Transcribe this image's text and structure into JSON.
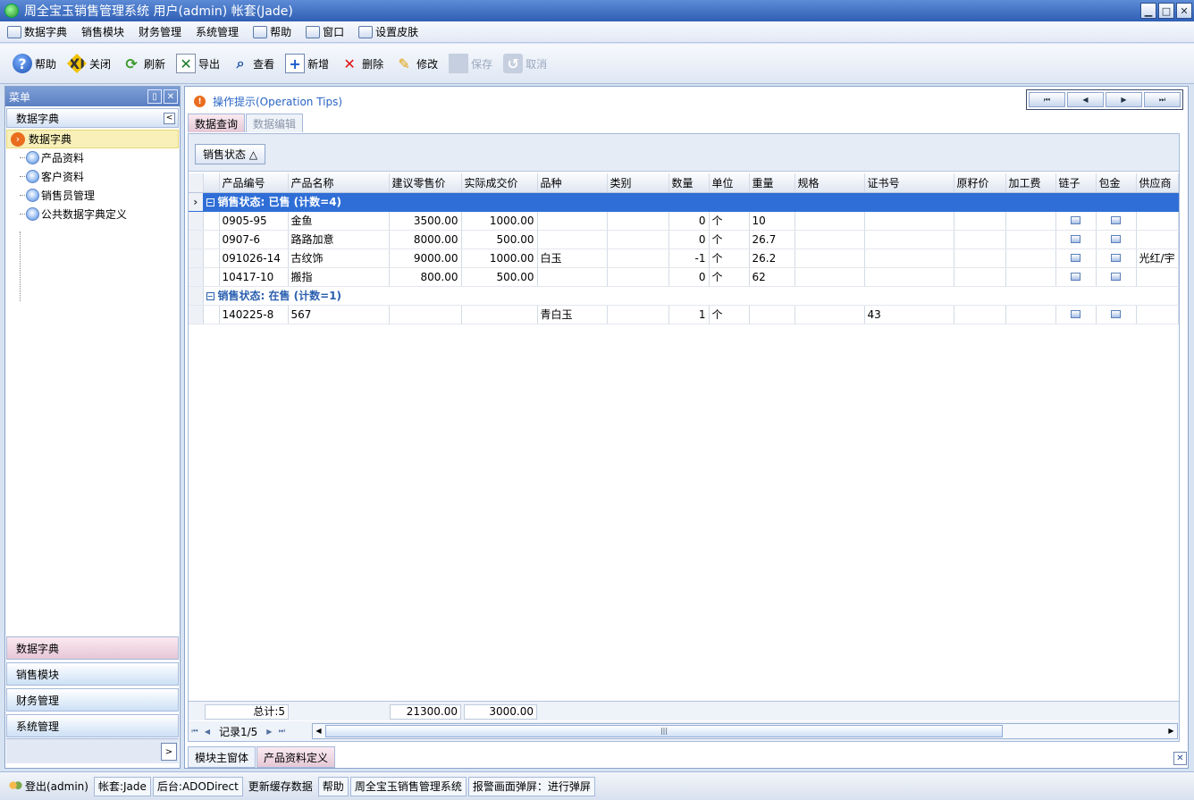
{
  "window": {
    "title": "周全宝玉销售管理系统 用户(admin) 帐套(Jade)"
  },
  "menu": [
    {
      "label": "数据字典",
      "icon": "tree-icon"
    },
    {
      "label": "销售模块"
    },
    {
      "label": "财务管理"
    },
    {
      "label": "系统管理"
    },
    {
      "label": "帮助",
      "icon": "help-icon"
    },
    {
      "label": "窗口",
      "icon": "window-icon"
    },
    {
      "label": "设置皮肤",
      "icon": "skin-icon"
    }
  ],
  "toolbar": {
    "help": "帮助",
    "close": "关闭",
    "close_icon_text": "EXIT",
    "refresh": "刷新",
    "export": "导出",
    "view": "查看",
    "new": "新增",
    "delete": "删除",
    "edit": "修改",
    "save": "保存",
    "cancel": "取消"
  },
  "sidebar": {
    "title": "菜单",
    "group": "数据字典",
    "root": "数据字典",
    "items": [
      "产品资料",
      "客户资料",
      "销售员管理",
      "公共数据字典定义"
    ],
    "nav": [
      "数据字典",
      "销售模块",
      "财务管理",
      "系统管理"
    ]
  },
  "main": {
    "tips": "操作提示(Operation Tips)",
    "tabs": [
      "数据查询",
      "数据编辑"
    ],
    "group_chip": "销售状态 △"
  },
  "grid": {
    "columns": [
      "产品编号",
      "产品名称",
      "建议零售价",
      "实际成交价",
      "品种",
      "类别",
      "数量",
      "单位",
      "重量",
      "规格",
      "证书号",
      "原籽价",
      "加工费",
      "链子",
      "包金",
      "供应商"
    ],
    "group1": "销售状态: 已售 (计数=4)",
    "group2": "销售状态: 在售 (计数=1)",
    "rows1": [
      {
        "code": "0905-95",
        "name": "金鱼",
        "retail": "3500.00",
        "actual": "1000.00",
        "variety": "",
        "qty": "0",
        "unit": "个",
        "weight": "10",
        "cert": "",
        "supplier": ""
      },
      {
        "code": "0907-6",
        "name": "路路加意",
        "retail": "8000.00",
        "actual": "500.00",
        "variety": "",
        "qty": "0",
        "unit": "个",
        "weight": "26.7",
        "cert": "",
        "supplier": ""
      },
      {
        "code": "091026-14",
        "name": "古纹饰",
        "retail": "9000.00",
        "actual": "1000.00",
        "variety": "白玉",
        "qty": "-1",
        "unit": "个",
        "weight": "26.2",
        "cert": "",
        "supplier": "光红/宇"
      },
      {
        "code": "10417-10",
        "name": "搬指",
        "retail": "800.00",
        "actual": "500.00",
        "variety": "",
        "qty": "0",
        "unit": "个",
        "weight": "62",
        "cert": "",
        "supplier": ""
      }
    ],
    "rows2": [
      {
        "code": "140225-8",
        "name": "567",
        "retail": "",
        "actual": "",
        "variety": "青白玉",
        "qty": "1",
        "unit": "个",
        "weight": "",
        "cert": "43",
        "supplier": ""
      }
    ],
    "footer": {
      "total": "总计:5",
      "retail_sum": "21300.00",
      "actual_sum": "3000.00"
    },
    "record": "记录1/5"
  },
  "bottom_tabs": [
    "模块主窗体",
    "产品资料定义"
  ],
  "status": {
    "login": "登出(admin)",
    "account": "帐套:Jade",
    "backend": "后台:ADODirect",
    "refresh": "更新缓存数据",
    "help": "帮助",
    "app": "周全宝玉销售管理系统",
    "alarm": "报警画面弹屏：进行弹屏"
  }
}
